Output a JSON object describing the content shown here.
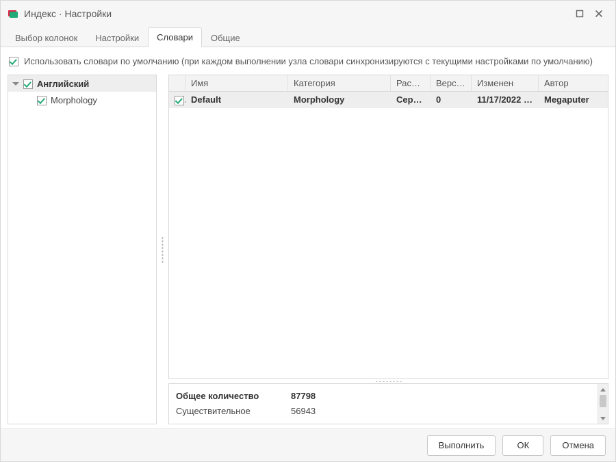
{
  "window": {
    "title": "Индекс · Настройки"
  },
  "tabs": {
    "items": [
      {
        "label": "Выбор колонок",
        "active": false
      },
      {
        "label": "Настройки",
        "active": false
      },
      {
        "label": "Словари",
        "active": true
      },
      {
        "label": "Общие",
        "active": false
      }
    ]
  },
  "option": {
    "use_default_label": "Использовать словари по умолчанию (при каждом выполнении узла словари синхронизируются с текущими настройками по умолчанию)",
    "checked": true
  },
  "tree": {
    "parent": {
      "label": "Английский",
      "checked": true,
      "expanded": true
    },
    "children": [
      {
        "label": "Morphology",
        "checked": true
      }
    ]
  },
  "grid": {
    "headers": {
      "name": "Имя",
      "category": "Категория",
      "location": "Распо…",
      "version": "Версия",
      "modified": "Изменен",
      "author": "Автор"
    },
    "rows": [
      {
        "checked": true,
        "name": "Default",
        "category": "Morphology",
        "location": "Сервер",
        "version": "0",
        "modified": "11/17/2022 …",
        "author": "Megaputer",
        "selected": true
      }
    ]
  },
  "stats": {
    "total_label": "Общее количество",
    "total_value": "87798",
    "rows": [
      {
        "label": "Существительное",
        "value": "56943"
      }
    ]
  },
  "footer": {
    "execute": "Выполнить",
    "ok": "ОК",
    "cancel": "Отмена"
  }
}
